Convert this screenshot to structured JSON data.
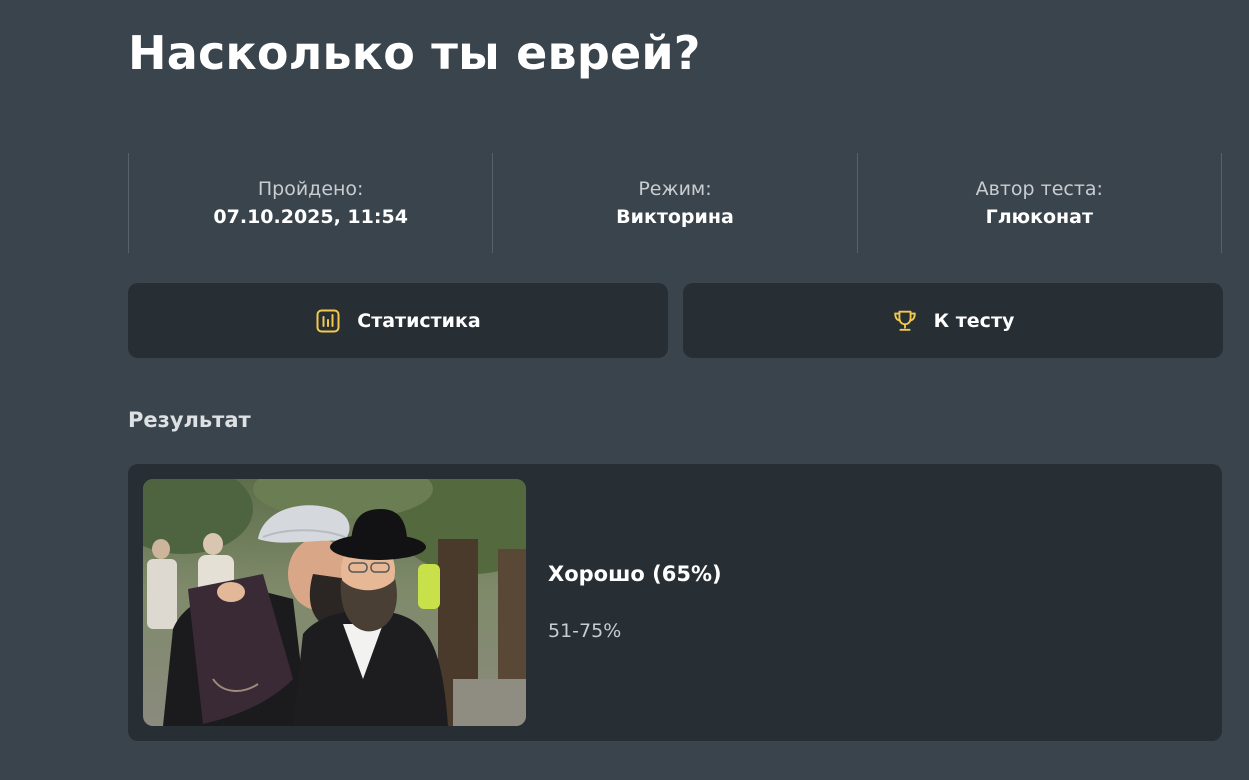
{
  "quiz": {
    "title": "Насколько ты еврей?"
  },
  "meta": {
    "completed_label": "Пройдено:",
    "completed_value": "07.10.2025, 11:54",
    "mode_label": "Режим:",
    "mode_value": "Викторина",
    "author_label": "Автор теста:",
    "author_value": "Глюконат"
  },
  "actions": {
    "stats_label": "Статистика",
    "stats_icon": "bar-chart-icon",
    "to_test_label": "К тесту",
    "to_test_icon": "trophy-icon",
    "icon_color": "#f2c94c"
  },
  "result": {
    "section_title": "Результат",
    "title": "Хорошо (65%)",
    "range": "51-75%"
  },
  "colors": {
    "background": "#3a444c",
    "card": "#272e34",
    "accent": "#f2c94c"
  }
}
